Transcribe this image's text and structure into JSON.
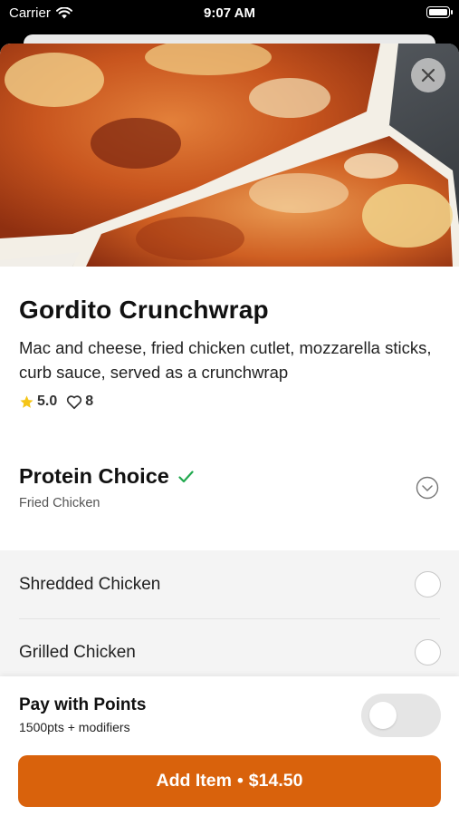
{
  "status_bar": {
    "carrier": "Carrier",
    "time": "9:07 AM"
  },
  "item": {
    "hero_image": "gordito-crunchwrap-photo",
    "close_icon": "close-icon",
    "title": "Gordito Crunchwrap",
    "description": "Mac and cheese, fried chicken cutlet, mozzarella sticks, curb sauce, served as a crunchwrap",
    "rating": "5.0",
    "likes": "8"
  },
  "protein": {
    "label": "Protein Choice",
    "selected_value": "Fried Chicken",
    "check_icon": "checkmark-icon",
    "expand_icon": "chevron-down-circle-icon",
    "options": [
      {
        "label": "Shredded Chicken"
      },
      {
        "label": "Grilled Chicken"
      }
    ]
  },
  "points": {
    "label": "Pay with Points",
    "sub": "1500pts + modifiers",
    "enabled": false
  },
  "cta": {
    "label": "Add Item",
    "separator": "•",
    "price": "$14.50"
  },
  "colors": {
    "accent": "#d9620c",
    "check": "#22a94f",
    "star": "#f5c518"
  }
}
